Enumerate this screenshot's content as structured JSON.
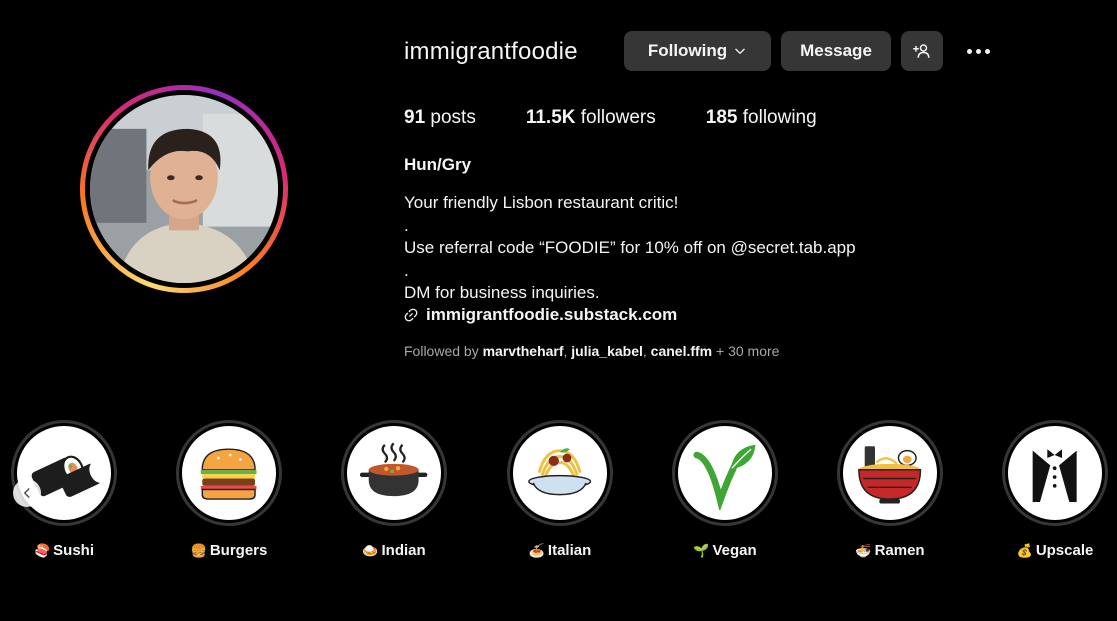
{
  "profile": {
    "username": "immigrantfoodie",
    "following_button": "Following",
    "message_button": "Message",
    "add_user_icon": "person-add-icon",
    "more_icon": "more-horizontal-icon",
    "avatar_icon": "profile-photo"
  },
  "stats": {
    "posts_count": "91",
    "posts_label": "posts",
    "followers_count": "11.5K",
    "followers_label": "followers",
    "following_count": "185",
    "following_label": "following"
  },
  "bio": {
    "display_name": "Hun/Gry",
    "line1": "Your friendly Lisbon restaurant critic!",
    "line2": ".",
    "line3": "Use referral code “FOODIE” for 10% off on @secret.tab.app",
    "line4": ".",
    "line5": "DM for business inquiries.",
    "link": "immigrantfoodie.substack.com",
    "link_icon": "link-icon"
  },
  "followed_by": {
    "prefix": "Followed by",
    "users": [
      "marvtheharf",
      "julia_kabel",
      "canel.ffm"
    ],
    "more": "+ 30 more"
  },
  "highlights": [
    {
      "emoji": "🍣",
      "label": "Sushi",
      "icon": "sushi-icon"
    },
    {
      "emoji": "🍔",
      "label": "Burgers",
      "icon": "burger-icon"
    },
    {
      "emoji": "🍛",
      "label": "Indian",
      "icon": "curry-pot-icon"
    },
    {
      "emoji": "🍝",
      "label": "Italian",
      "icon": "pasta-icon"
    },
    {
      "emoji": "🌱",
      "label": "Vegan",
      "icon": "vegan-leaf-icon"
    },
    {
      "emoji": "🍜",
      "label": "Ramen",
      "icon": "ramen-bowl-icon"
    },
    {
      "emoji": "💰",
      "label": "Upscale",
      "icon": "tuxedo-icon"
    }
  ],
  "carousel": {
    "prev_icon": "chevron-left-icon"
  }
}
